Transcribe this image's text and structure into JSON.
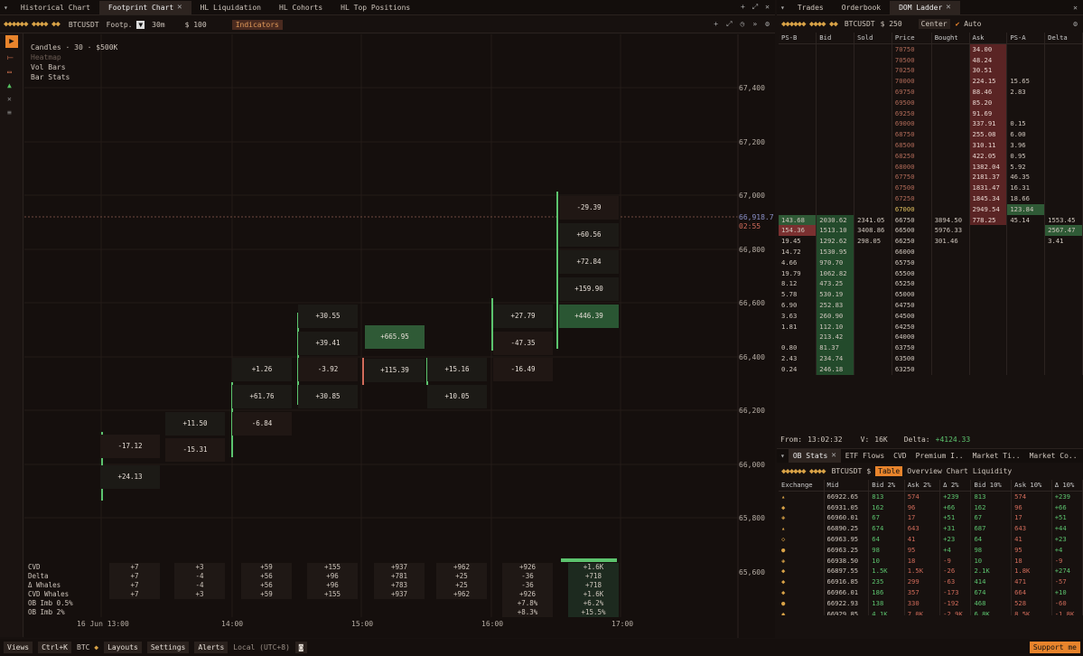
{
  "tabs": [
    "Historical Chart",
    "Footprint Chart",
    "HL Liquidation",
    "HL Cohorts",
    "HL Top Positions"
  ],
  "toolbar": {
    "symbol": "BTCUSDT",
    "chart_type": "Footp.",
    "timeframe": "30m",
    "step": "$ 100",
    "indicators": "Indicators"
  },
  "legend": {
    "candles": "Candles · 30 · $500K",
    "items": [
      "Heatmap",
      "Vol Bars",
      "Bar Stats"
    ]
  },
  "price_axis": [
    "67,400",
    "67,200",
    "67,000",
    "66,800",
    "66,600",
    "66,400",
    "66,200",
    "66,000",
    "65,800",
    "65,600"
  ],
  "current_price": "66,918.7",
  "countdown": "02:55",
  "time_axis": [
    "16 Jun 13:00",
    "14:00",
    "15:00",
    "16:00",
    "17:00"
  ],
  "footprint_columns": [
    {
      "cells": [
        "-17.12",
        "+24.13"
      ]
    },
    {
      "cells": [
        "+11.50",
        "-15.31"
      ]
    },
    {
      "cells": [
        "+1.26",
        "+61.76",
        "-6.84"
      ]
    },
    {
      "cells": [
        "+30.55",
        "+39.41",
        "-3.92",
        "+30.85"
      ]
    },
    {
      "cells": [
        "+665.95",
        "+115.39"
      ]
    },
    {
      "cells": [
        "+15.16",
        "+10.05"
      ]
    },
    {
      "cells": [
        "+27.79",
        "-47.35",
        "-16.49"
      ]
    },
    {
      "cells": [
        "-29.39",
        "+60.56",
        "+72.84",
        "+159.90",
        "+446.39"
      ]
    }
  ],
  "stats": {
    "labels": [
      "CVD",
      "Delta",
      "Δ Whales",
      "CVD Whales",
      "OB Imb 0.5%",
      "OB Imb 2%"
    ],
    "columns": [
      [
        "+7",
        "+7",
        "+7",
        "+7",
        "",
        ""
      ],
      [
        "+3",
        "-4",
        "-4",
        "+3",
        "",
        ""
      ],
      [
        "+59",
        "+56",
        "+56",
        "+59",
        "",
        ""
      ],
      [
        "+155",
        "+96",
        "+96",
        "+155",
        "",
        ""
      ],
      [
        "+937",
        "+781",
        "+783",
        "+937",
        "",
        ""
      ],
      [
        "+962",
        "+25",
        "+25",
        "+962",
        "",
        ""
      ],
      [
        "+926",
        "-36",
        "-36",
        "+926",
        "+7.8%",
        "+8.3%"
      ],
      [
        "+1.6K",
        "+718",
        "+718",
        "+1.6K",
        "+6.2%",
        "+15.5%"
      ]
    ]
  },
  "right_tabs": [
    "Trades",
    "Orderbook",
    "DOM Ladder"
  ],
  "dom": {
    "symbol": "BTCUSDT",
    "size": "$ 250",
    "center": "Center",
    "auto": "Auto",
    "headers": [
      "PS-B",
      "Bid",
      "Sold",
      "Price",
      "Bought",
      "Ask",
      "PS-A",
      "Delta"
    ],
    "rows": [
      [
        "",
        "",
        "",
        "70750",
        "",
        "34.00",
        "",
        ""
      ],
      [
        "",
        "",
        "",
        "70500",
        "",
        "48.24",
        "",
        ""
      ],
      [
        "",
        "",
        "",
        "70250",
        "",
        "30.51",
        "",
        ""
      ],
      [
        "",
        "",
        "",
        "70000",
        "",
        "224.15",
        "15.65",
        ""
      ],
      [
        "",
        "",
        "",
        "69750",
        "",
        "88.46",
        "2.83",
        ""
      ],
      [
        "",
        "",
        "",
        "69500",
        "",
        "85.20",
        "",
        ""
      ],
      [
        "",
        "",
        "",
        "69250",
        "",
        "91.69",
        "",
        ""
      ],
      [
        "",
        "",
        "",
        "69000",
        "",
        "337.91",
        "0.15",
        ""
      ],
      [
        "",
        "",
        "",
        "68750",
        "",
        "255.08",
        "6.00",
        ""
      ],
      [
        "",
        "",
        "",
        "68500",
        "",
        "310.11",
        "3.96",
        ""
      ],
      [
        "",
        "",
        "",
        "68250",
        "",
        "422.05",
        "0.95",
        ""
      ],
      [
        "",
        "",
        "",
        "68000",
        "",
        "1382.04",
        "5.92",
        ""
      ],
      [
        "",
        "",
        "",
        "67750",
        "",
        "2181.37",
        "46.35",
        ""
      ],
      [
        "",
        "",
        "",
        "67500",
        "",
        "1831.47",
        "16.31",
        ""
      ],
      [
        "",
        "",
        "",
        "67250",
        "",
        "1845.34",
        "18.66",
        ""
      ],
      [
        "",
        "",
        "",
        "67000",
        "",
        "2949.54",
        "123.84",
        ""
      ],
      [
        "143.68",
        "2030.62",
        "2341.05",
        "66750",
        "3894.50",
        "778.25",
        "45.14",
        "1553.45"
      ],
      [
        "154.36",
        "1513.10",
        "3408.86",
        "66500",
        "5976.33",
        "",
        "",
        "2567.47"
      ],
      [
        "19.45",
        "1292.62",
        "298.05",
        "66250",
        "301.46",
        "",
        "",
        "3.41"
      ],
      [
        "14.72",
        "1530.95",
        "",
        "66000",
        "",
        "",
        "",
        ""
      ],
      [
        "4.66",
        "970.70",
        "",
        "65750",
        "",
        "",
        "",
        ""
      ],
      [
        "19.79",
        "1062.82",
        "",
        "65500",
        "",
        "",
        "",
        ""
      ],
      [
        "8.12",
        "473.25",
        "",
        "65250",
        "",
        "",
        "",
        ""
      ],
      [
        "5.78",
        "530.19",
        "",
        "65000",
        "",
        "",
        "",
        ""
      ],
      [
        "6.90",
        "252.83",
        "",
        "64750",
        "",
        "",
        "",
        ""
      ],
      [
        "3.63",
        "260.90",
        "",
        "64500",
        "",
        "",
        "",
        ""
      ],
      [
        "1.81",
        "112.10",
        "",
        "64250",
        "",
        "",
        "",
        ""
      ],
      [
        "",
        "213.42",
        "",
        "64000",
        "",
        "",
        "",
        ""
      ],
      [
        "0.80",
        "81.37",
        "",
        "63750",
        "",
        "",
        "",
        ""
      ],
      [
        "2.43",
        "234.74",
        "",
        "63500",
        "",
        "",
        "",
        ""
      ],
      [
        "0.24",
        "246.18",
        "",
        "63250",
        "",
        "",
        "",
        ""
      ]
    ],
    "status": {
      "from_label": "From:",
      "from": "13:02:32",
      "v_label": "V:",
      "v": "16K",
      "delta_label": "Delta:",
      "delta": "+4124.33"
    }
  },
  "ob_tabs": [
    "OB Stats",
    "ETF Flows",
    "CVD",
    "Premium I..",
    "Market Ti..",
    "Market Co.."
  ],
  "ob": {
    "symbol": "BTCUSDT",
    "views": [
      "Table",
      "Overview",
      "Chart",
      "Liquidity"
    ],
    "headers": [
      "Exchange",
      "Mid",
      "Bid 2%",
      "Ask 2%",
      "Δ 2%",
      "Bid 10%",
      "Ask 10%",
      "Δ 10%"
    ],
    "rows": [
      [
        "66922.65",
        "813",
        "574",
        "+239",
        "813",
        "574",
        "+239"
      ],
      [
        "66931.05",
        "162",
        "96",
        "+66",
        "162",
        "96",
        "+66"
      ],
      [
        "66960.01",
        "67",
        "17",
        "+51",
        "67",
        "17",
        "+51"
      ],
      [
        "66890.25",
        "674",
        "643",
        "+31",
        "687",
        "643",
        "+44"
      ],
      [
        "66963.95",
        "64",
        "41",
        "+23",
        "64",
        "41",
        "+23"
      ],
      [
        "66963.25",
        "98",
        "95",
        "+4",
        "98",
        "95",
        "+4"
      ],
      [
        "66938.50",
        "10",
        "18",
        "-9",
        "10",
        "18",
        "-9"
      ],
      [
        "66897.55",
        "1.5K",
        "1.5K",
        "-26",
        "2.1K",
        "1.8K",
        "+274"
      ],
      [
        "66916.85",
        "235",
        "299",
        "-63",
        "414",
        "471",
        "-57"
      ],
      [
        "66966.01",
        "186",
        "357",
        "-173",
        "674",
        "664",
        "+10"
      ],
      [
        "66922.93",
        "138",
        "330",
        "-192",
        "468",
        "528",
        "-60"
      ],
      [
        "66929.85",
        "4.1K",
        "7.0K",
        "-2.9K",
        "6.8K",
        "8.5K",
        "-1.8K"
      ]
    ]
  },
  "footer": {
    "views": "Views",
    "shortcut": "Ctrl+K",
    "coin": "BTC",
    "layouts": "Layouts",
    "settings": "Settings",
    "alerts": "Alerts",
    "tz": "Local (UTC+8)",
    "support": "Support me"
  }
}
